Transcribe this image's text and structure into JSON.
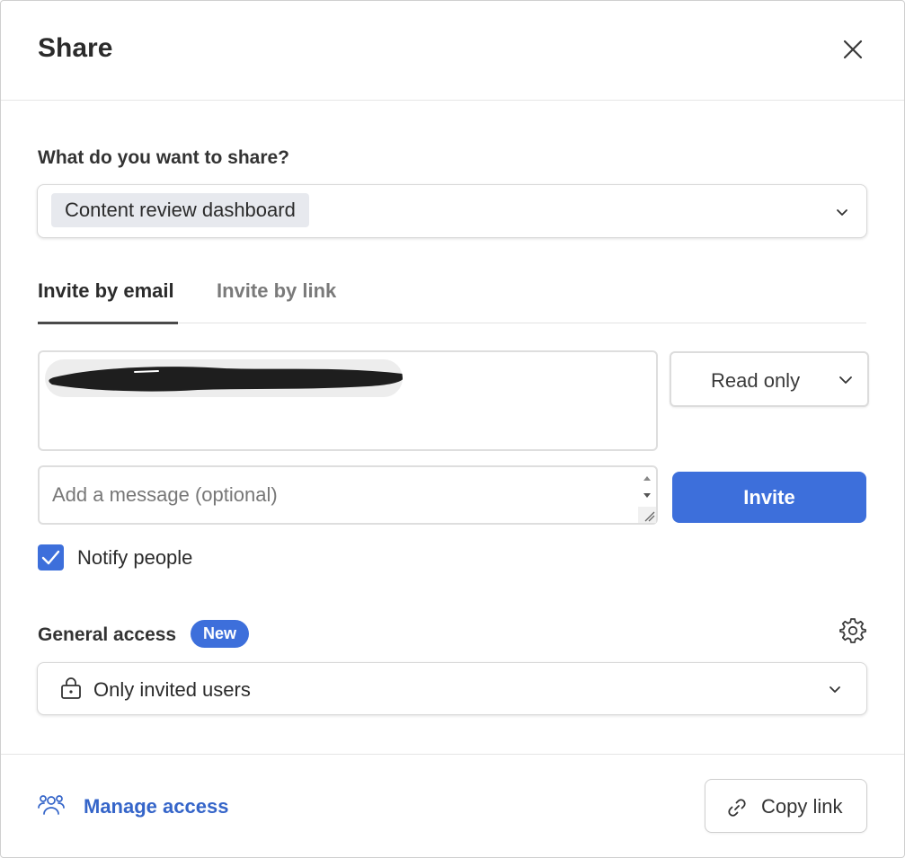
{
  "dialog": {
    "title": "Share"
  },
  "share_target": {
    "label": "What do you want to share?",
    "selected": "Content review dashboard"
  },
  "tabs": [
    {
      "label": "Invite by email",
      "active": true
    },
    {
      "label": "Invite by link",
      "active": false
    }
  ],
  "invite": {
    "permission": "Read only",
    "message_placeholder": "Add a message (optional)",
    "invite_label": "Invite",
    "notify_label": "Notify people",
    "notify_checked": true
  },
  "general_access": {
    "label": "General access",
    "badge": "New",
    "selected": "Only invited users"
  },
  "footer": {
    "manage_label": "Manage access",
    "copy_label": "Copy link"
  },
  "colors": {
    "accent": "#3d6fdb",
    "link": "#3565c9"
  },
  "icons": [
    "close-icon",
    "chevron-down-icon",
    "lock-icon",
    "gear-icon",
    "people-icon",
    "link-icon",
    "checkmark-icon"
  ]
}
